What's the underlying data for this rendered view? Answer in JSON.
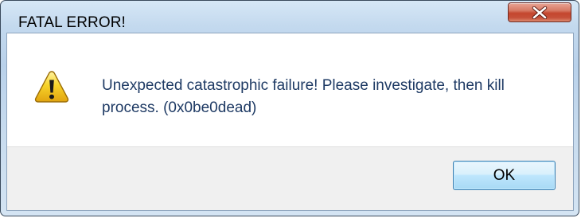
{
  "window": {
    "title": "FATAL ERROR!",
    "close_icon": "close-x-icon"
  },
  "dialog": {
    "icon": "warning-icon",
    "message": "Unexpected catastrophic failure! Please investigate, then kill process. (0x0be0dead)",
    "ok_label": "OK"
  },
  "colors": {
    "message_text": "#1e3a64",
    "close_button": "#c4462e",
    "warning_yellow": "#f7c51c"
  }
}
